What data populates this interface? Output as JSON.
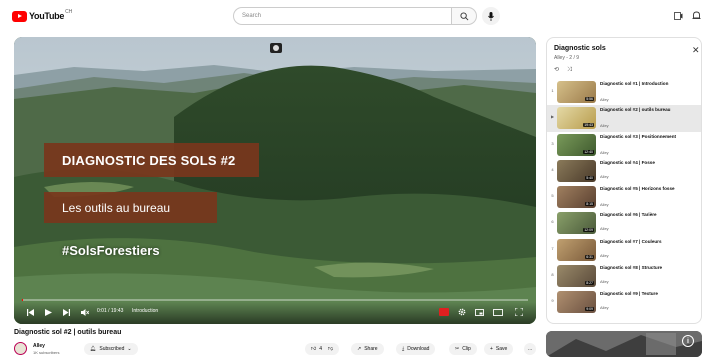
{
  "header": {
    "logo_text": "YouTube",
    "logo_country": "CH",
    "search_placeholder": "Search",
    "icons": [
      "search-icon",
      "mic-icon",
      "create-icon",
      "notifications-icon"
    ]
  },
  "player": {
    "overlay_title": "DIAGNOSTIC DES SOLS #2",
    "overlay_subtitle": "Les outils au bureau",
    "overlay_hashtag": "#SolsForestiers",
    "time": "0:01 / 19:43",
    "chapter": "Introduction",
    "progress": 0.001,
    "colors": {
      "overlay_box": "#78361c"
    }
  },
  "video": {
    "title": "Diagnostic sol #2 | outils bureau",
    "channel_name": "Alley",
    "channel_subs": "1K subscribers",
    "subscribed_label": "Subscribed",
    "actions": {
      "like": "4",
      "share": "Share",
      "download": "Download",
      "clip": "Clip",
      "save": "Save",
      "more": "..."
    }
  },
  "playlist": {
    "title": "Diagnostic sols",
    "subtitle": "Alley - 2 / 9",
    "items": [
      {
        "idx": "1",
        "name": "Diagnostic sol #1 | Introduction",
        "channel": "Alley",
        "duration": "5:56"
      },
      {
        "idx": "▶",
        "name": "Diagnostic sol #2 | outils bureau",
        "channel": "Alley",
        "duration": "19:43"
      },
      {
        "idx": "3",
        "name": "Diagnostic sol #3 | Positionnement",
        "channel": "Alley",
        "duration": "12:40"
      },
      {
        "idx": "4",
        "name": "Diagnostic sol #4 | Fosse",
        "channel": "Alley",
        "duration": "5:40"
      },
      {
        "idx": "5",
        "name": "Diagnostic sol #5 | Horizons fosse",
        "channel": "Alley",
        "duration": "8:15"
      },
      {
        "idx": "6",
        "name": "Diagnostic sol #6 | Tarière",
        "channel": "Alley",
        "duration": "12:09"
      },
      {
        "idx": "7",
        "name": "Diagnostic sol #7 | Couleurs",
        "channel": "Alley",
        "duration": "6:31"
      },
      {
        "idx": "8",
        "name": "Diagnostic sol #8 | Structure",
        "channel": "Alley",
        "duration": "8:27"
      },
      {
        "idx": "9",
        "name": "Diagnostic sol #9 | Texture",
        "channel": "Alley",
        "duration": "9:09"
      }
    ]
  }
}
